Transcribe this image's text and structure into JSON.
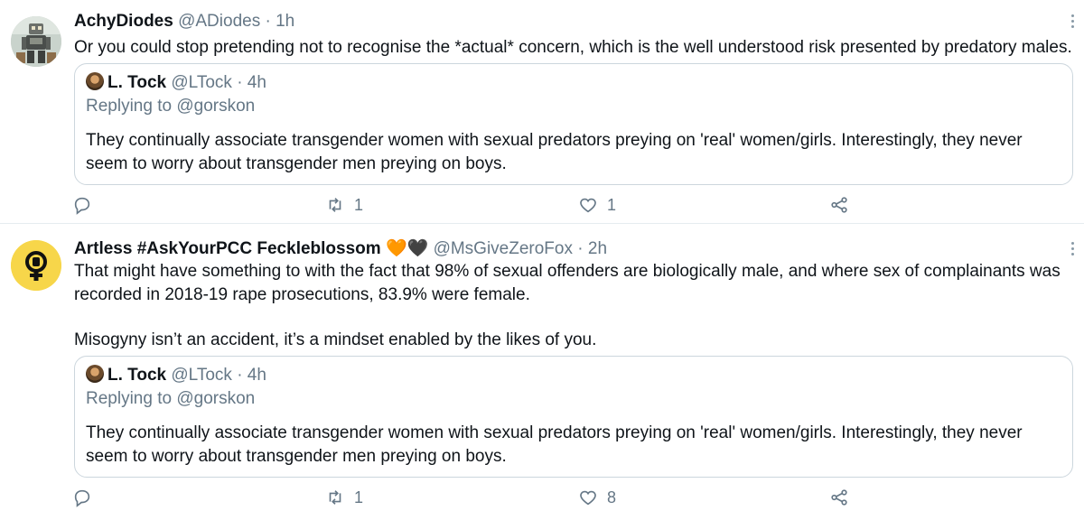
{
  "tweets": [
    {
      "name": "AchyDiodes",
      "handle": "@ADiodes",
      "dot": "·",
      "time": "1h",
      "text": "Or you could stop pretending not to recognise the *actual* concern, which is the well understood risk presented by predatory males.",
      "quote": {
        "name": "L. Tock",
        "handle": "@LTock",
        "dot": "·",
        "time": "4h",
        "replying_prefix": "Replying to",
        "replying_to": "@gorskon",
        "text": "They continually associate transgender women with sexual predators preying on 'real' women/girls.  Interestingly,  they never seem to worry about transgender men preying on boys."
      },
      "actions": {
        "reply_count": "",
        "retweet_count": "1",
        "like_count": "1"
      }
    },
    {
      "name": "Artless #AskYourPCC Feckleblossom",
      "emoji": "🧡🖤",
      "handle": "@MsGiveZeroFox",
      "dot": "·",
      "time": "2h",
      "text_p1": "That might have something to with the fact that 98% of sexual offenders are biologically male, and where sex of complainants was recorded in 2018-19 rape prosecutions, 83.9% were female.",
      "text_p2": "Misogyny isn’t an accident, it’s a mindset enabled by the likes of you.",
      "quote": {
        "name": "L. Tock",
        "handle": "@LTock",
        "dot": "·",
        "time": "4h",
        "replying_prefix": "Replying to",
        "replying_to": "@gorskon",
        "text": "They continually associate transgender women with sexual predators preying on 'real' women/girls.  Interestingly,  they never seem to worry about transgender men preying on boys."
      },
      "actions": {
        "reply_count": "",
        "retweet_count": "1",
        "like_count": "8"
      }
    }
  ],
  "colors": {
    "secondary_text": "#657786",
    "border": "#ccd6dd",
    "avatar_yellow": "#f7d64a"
  }
}
